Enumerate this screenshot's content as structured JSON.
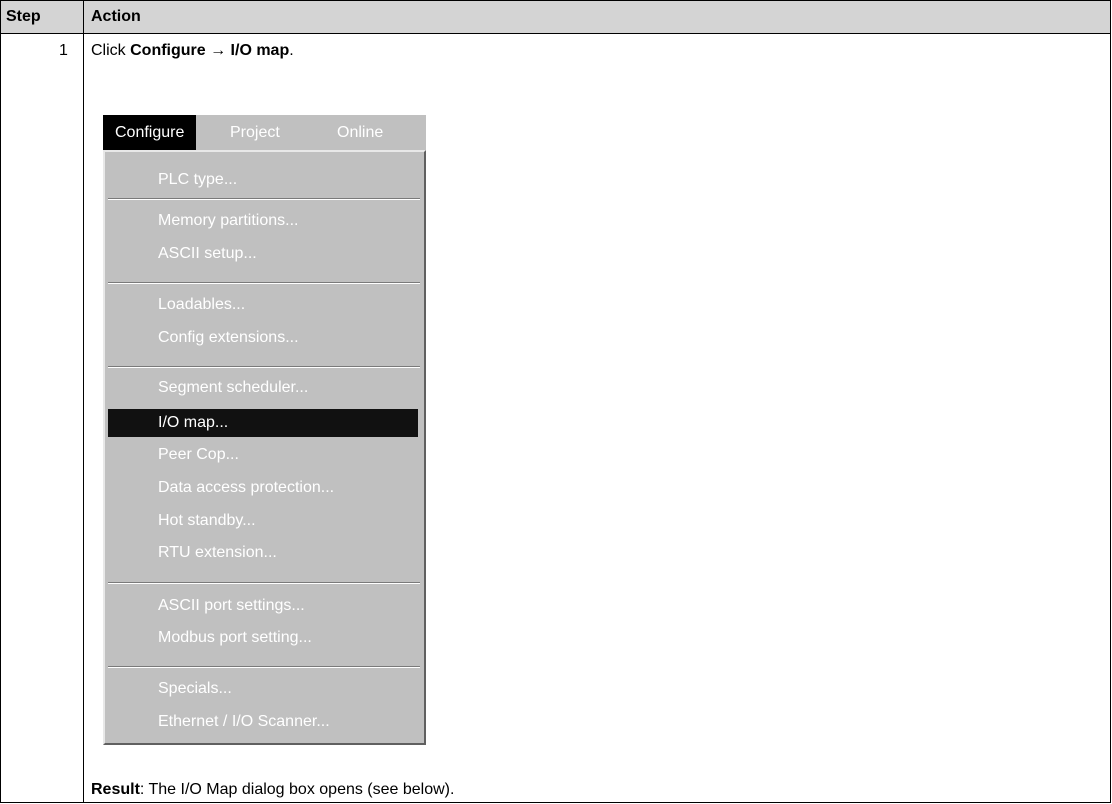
{
  "table": {
    "header_step": "Step",
    "header_action": "Action",
    "step_number": "1",
    "instruction_prefix": "Click ",
    "instruction_path": "Configure → I/O map",
    "instruction_suffix": ".",
    "result_label": "Result",
    "result_text": ": The I/O Map dialog box opens (see below)."
  },
  "menubar": {
    "items": [
      "Configure",
      "Project",
      "Online"
    ],
    "active": "Configure"
  },
  "menu": {
    "items": [
      "PLC type...",
      "Memory partitions...",
      "ASCII setup...",
      "Loadables...",
      "Config extensions...",
      "Segment scheduler...",
      "I/O map...",
      "Peer Cop...",
      "Data access protection...",
      "Hot standby...",
      "RTU extension...",
      "ASCII port settings...",
      "Modbus port setting...",
      "Specials...",
      "Ethernet / I/O Scanner..."
    ],
    "highlighted": "I/O map..."
  },
  "colors": {
    "header_bg": "#d4d4d4",
    "menu_bg": "#c0c0c0",
    "highlight_bg": "#111111",
    "menu_text": "#ffffff"
  }
}
